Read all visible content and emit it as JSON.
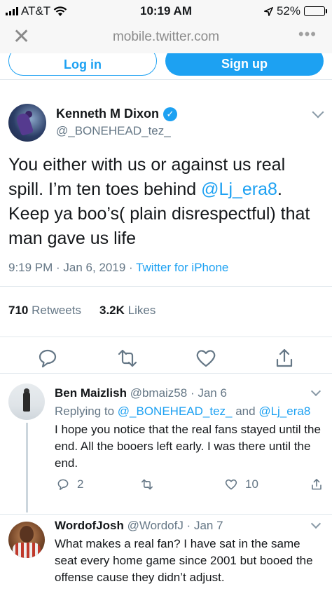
{
  "status_bar": {
    "carrier": "AT&T",
    "time": "10:19 AM",
    "battery": "52%",
    "battery_level": 0.52
  },
  "browser": {
    "url": "mobile.twitter.com"
  },
  "auth": {
    "login_label": "Log in",
    "signup_label": "Sign up"
  },
  "tweet": {
    "author_name": "Kenneth M Dixon",
    "author_handle": "@_BONEHEAD_tez_",
    "text_part1": "You either with us or against us real spill. I’m ten toes behind ",
    "mention": "@Lj_era8",
    "text_part2": ". Keep ya boo’s( plain disrespectful)  that man gave us life",
    "time": "9:19 PM · Jan 6, 2019 · ",
    "source": "Twitter for iPhone",
    "retweets_count": "710",
    "retweets_label": "Retweets",
    "likes_count": "3.2K",
    "likes_label": "Likes"
  },
  "replies": [
    {
      "name": "Ben Maizlish",
      "handle_date": "@bmaiz58 · Jan 6",
      "replying_prefix": "Replying to ",
      "replying_to_1": "@_BONEHEAD_tez_",
      "replying_and": " and ",
      "replying_to_2": "@Lj_era8",
      "text": "I hope you notice that the real fans stayed until the end. All the booers left early. I was there until the end.",
      "reply_count": "2",
      "like_count": "10"
    },
    {
      "name": "WordofJosh",
      "handle_date": "@WordofJ · Jan 7",
      "text": "What makes a real fan?  I have sat in the same seat every home game since 2001 but booed the offense cause they didn’t adjust."
    }
  ],
  "colors": {
    "accent": "#1da1f2",
    "muted": "#657786",
    "border": "#e1e8ed"
  }
}
